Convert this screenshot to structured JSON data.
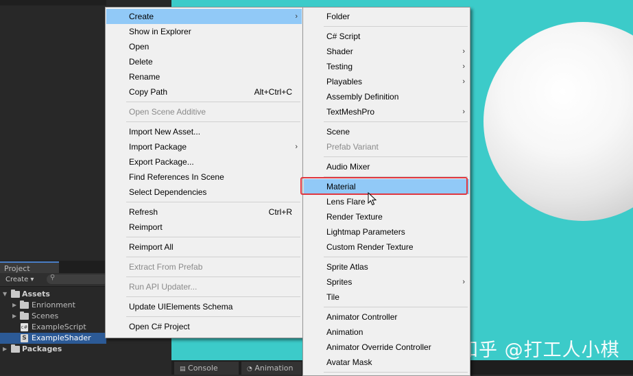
{
  "project_panel": {
    "tab_label": "Project",
    "create_label": "Create ▾",
    "tree": [
      {
        "label": "Assets",
        "type": "folder-root"
      },
      {
        "label": "Enrionment",
        "type": "folder"
      },
      {
        "label": "Scenes",
        "type": "folder"
      },
      {
        "label": "ExampleScript",
        "type": "file"
      },
      {
        "label": "ExampleShader",
        "type": "shader",
        "selected": true
      },
      {
        "label": "Packages",
        "type": "folder-root"
      }
    ]
  },
  "bottom_tabs": {
    "console": "Console",
    "animation": "Animation"
  },
  "context_menu": {
    "items": [
      {
        "label": "Create",
        "submenu": true,
        "active": true
      },
      {
        "label": "Show in Explorer"
      },
      {
        "label": "Open"
      },
      {
        "label": "Delete"
      },
      {
        "label": "Rename"
      },
      {
        "label": "Copy Path",
        "shortcut": "Alt+Ctrl+C"
      },
      {
        "label": "Open Scene Additive",
        "disabled": true
      },
      {
        "label": "Import New Asset..."
      },
      {
        "label": "Import Package",
        "submenu": true
      },
      {
        "label": "Export Package..."
      },
      {
        "label": "Find References In Scene"
      },
      {
        "label": "Select Dependencies"
      },
      {
        "label": "Refresh",
        "shortcut": "Ctrl+R"
      },
      {
        "label": "Reimport"
      },
      {
        "label": "Reimport All"
      },
      {
        "label": "Extract From Prefab",
        "disabled": true
      },
      {
        "label": "Run API Updater...",
        "disabled": true
      },
      {
        "label": "Update UIElements Schema"
      },
      {
        "label": "Open C# Project"
      }
    ]
  },
  "create_submenu": {
    "items": [
      {
        "label": "Folder"
      },
      {
        "label": "C# Script"
      },
      {
        "label": "Shader",
        "submenu": true
      },
      {
        "label": "Testing",
        "submenu": true
      },
      {
        "label": "Playables",
        "submenu": true
      },
      {
        "label": "Assembly Definition"
      },
      {
        "label": "TextMeshPro",
        "submenu": true
      },
      {
        "label": "Scene"
      },
      {
        "label": "Prefab Variant",
        "disabled": true
      },
      {
        "label": "Audio Mixer"
      },
      {
        "label": "Material",
        "active": true
      },
      {
        "label": "Lens Flare"
      },
      {
        "label": "Render Texture"
      },
      {
        "label": "Lightmap Parameters"
      },
      {
        "label": "Custom Render Texture"
      },
      {
        "label": "Sprite Atlas"
      },
      {
        "label": "Sprites",
        "submenu": true
      },
      {
        "label": "Tile"
      },
      {
        "label": "Animator Controller"
      },
      {
        "label": "Animation"
      },
      {
        "label": "Animator Override Controller"
      },
      {
        "label": "Avatar Mask"
      }
    ]
  },
  "watermark": "知乎 @打工人小棋",
  "colors": {
    "scene_bg": "#3ccbc9",
    "menu_highlight": "#91c9f7",
    "annotation_box": "#e0363f",
    "selection": "#2c5a96"
  }
}
